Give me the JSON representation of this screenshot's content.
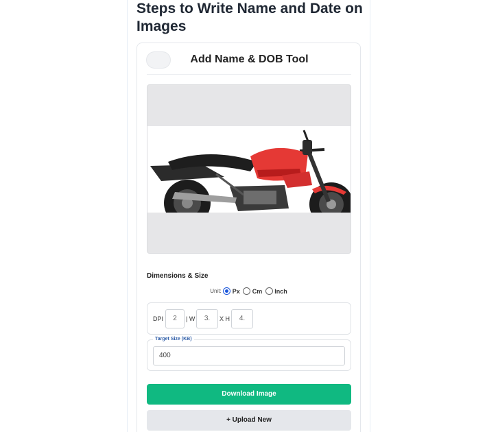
{
  "page": {
    "heading": "Steps to Write Name and Date on Images"
  },
  "tool": {
    "title": "Add Name & DOB Tool",
    "toggle_icon": "toggle-switch-icon"
  },
  "preview": {
    "image_subject": "red-motorcycle-image"
  },
  "dimensions": {
    "section_label": "Dimensions & Size",
    "unit_label": "Unit:",
    "units": [
      "Px",
      "Cm",
      "Inch"
    ],
    "selected_unit": "Px",
    "dpi_label": "DPI",
    "dpi_value": "2",
    "width_label": "| W",
    "width_value": "3.",
    "height_label": "X H",
    "height_value": "4."
  },
  "target": {
    "legend": "Target Size (KB)",
    "value": "400"
  },
  "actions": {
    "download_label": "Download Image",
    "upload_label": "+ Upload New"
  },
  "colors": {
    "accent_green": "#10b981",
    "radio_blue": "#1a56db",
    "legend_blue": "#2f5ea8"
  }
}
